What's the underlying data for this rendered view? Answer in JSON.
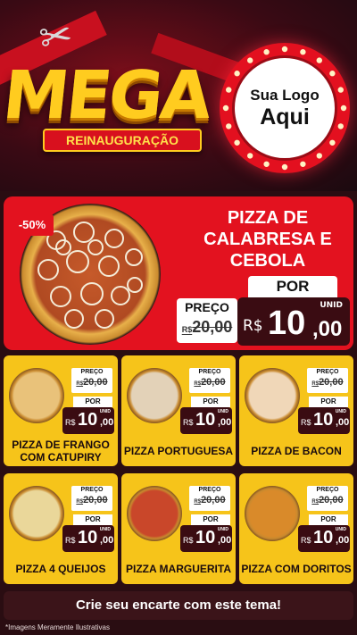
{
  "header": {
    "title_main": "MEGA",
    "title_sub": "REINAUGURAÇÃO",
    "logo": {
      "line1": "Sua Logo",
      "line2": "Aqui"
    }
  },
  "hero": {
    "discount": "-50%",
    "name": "PIZZA DE CALABRESA E CEBOLA",
    "preco_label": "PREÇO",
    "old_currency": "R$",
    "old_price": "20,00",
    "por_label": "POR",
    "unid_label": "UNID",
    "currency": "R$",
    "price_int": "10",
    "price_cents": ",00"
  },
  "cards": [
    {
      "name": "PIZZA DE FRANGO COM CATUPIRY",
      "preco_label": "PREÇO",
      "old_currency": "R$",
      "old_price": "20,00",
      "por_label": "POR",
      "unid_label": "UNID",
      "currency": "R$",
      "price_int": "10",
      "price_cents": ",00",
      "color": "#e9c27a"
    },
    {
      "name": "PIZZA PORTUGUESA",
      "preco_label": "PREÇO",
      "old_currency": "R$",
      "old_price": "20,00",
      "por_label": "POR",
      "unid_label": "UNID",
      "currency": "R$",
      "price_int": "10",
      "price_cents": ",00",
      "color": "#e3d2b8"
    },
    {
      "name": "PIZZA DE BACON",
      "preco_label": "PREÇO",
      "old_currency": "R$",
      "old_price": "20,00",
      "por_label": "POR",
      "unid_label": "UNID",
      "currency": "R$",
      "price_int": "10",
      "price_cents": ",00",
      "color": "#f0d7b8"
    },
    {
      "name": "PIZZA 4 QUEIJOS",
      "preco_label": "PREÇO",
      "old_currency": "R$",
      "old_price": "20,00",
      "por_label": "POR",
      "unid_label": "UNID",
      "currency": "R$",
      "price_int": "10",
      "price_cents": ",00",
      "color": "#ead79a"
    },
    {
      "name": "PIZZA MARGUERITA",
      "preco_label": "PREÇO",
      "old_currency": "R$",
      "old_price": "20,00",
      "por_label": "POR",
      "unid_label": "UNID",
      "currency": "R$",
      "price_int": "10",
      "price_cents": ",00",
      "color": "#c9472a"
    },
    {
      "name": "PIZZA COM DORITOS",
      "preco_label": "PREÇO",
      "old_currency": "R$",
      "old_price": "20,00",
      "por_label": "POR",
      "unid_label": "UNID",
      "currency": "R$",
      "price_int": "10",
      "price_cents": ",00",
      "color": "#d98a2a"
    }
  ],
  "cta": "Crie seu encarte com este tema!",
  "disclaimer": "*Imagens Meramente Ilustrativas",
  "colors": {
    "accent_red": "#e3121f",
    "card_yellow": "#f6c41a",
    "price_dark": "#3a0c12",
    "title_gold": "#ffcc1f"
  }
}
